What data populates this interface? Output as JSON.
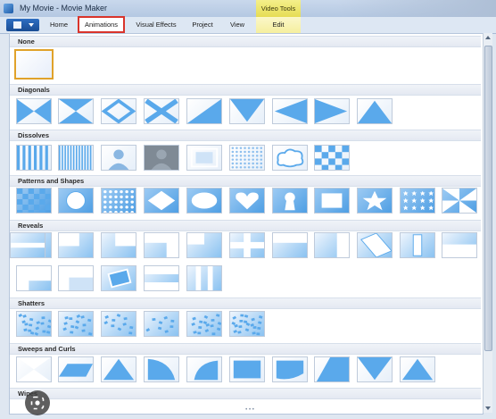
{
  "window": {
    "title": "My Movie - Movie Maker",
    "context_tab": "Video Tools"
  },
  "tabs": [
    {
      "label": "Home",
      "active": false
    },
    {
      "label": "Animations",
      "active": true
    },
    {
      "label": "Visual Effects",
      "active": false
    },
    {
      "label": "Project",
      "active": false
    },
    {
      "label": "View",
      "active": false
    },
    {
      "label": "Edit",
      "active": false
    }
  ],
  "gallery": {
    "sections": [
      {
        "label": "None",
        "items": [
          "none"
        ]
      },
      {
        "label": "Diagonals",
        "items": [
          "diag-x",
          "diag-x-out",
          "diag-diamond",
          "diag-x-bars",
          "diag-split",
          "diag-chevron-down",
          "diag-arrow-left",
          "diag-arrow-right",
          "diag-triangle-up"
        ]
      },
      {
        "label": "Dissolves",
        "items": [
          "dissolve-bars",
          "dissolve-lines",
          "dissolve-person",
          "dissolve-fade-dark",
          "dissolve-frames",
          "dissolve-dots",
          "dissolve-cloud",
          "dissolve-checker"
        ]
      },
      {
        "label": "Patterns and Shapes",
        "items": [
          "pattern-checker",
          "pattern-circle",
          "pattern-dots",
          "pattern-diamond",
          "pattern-ellipse",
          "pattern-heart",
          "pattern-keyhole",
          "pattern-rectangle",
          "pattern-star",
          "pattern-stars",
          "pattern-pinwheel"
        ]
      },
      {
        "label": "Reveals",
        "items": [
          "reveal-rotate",
          "reveal-corner-tl",
          "reveal-corner-tr",
          "reveal-slide-up",
          "reveal-box-br",
          "reveal-cross",
          "reveal-band",
          "reveal-bar-right",
          "reveal-tilt",
          "reveal-bar-center",
          "reveal-bar-top",
          "reveal-split-h",
          "reveal-corner-bl",
          "reveal-box-tl",
          "reveal-tilted-card",
          "reveal-split-v",
          "reveal-bars-v"
        ]
      },
      {
        "label": "Shatters",
        "items": [
          "shatter-1",
          "shatter-2",
          "shatter-3",
          "shatter-4",
          "shatter-5",
          "shatter-6"
        ]
      },
      {
        "label": "Sweeps and Curls",
        "items": [
          "sweep-bowtie",
          "sweep-trapezoid",
          "sweep-triangle",
          "curl-left",
          "curl-corner",
          "curl-page",
          "curl-bottom",
          "sweep-diagonal",
          "sweep-chevron",
          "sweep-triangle-up"
        ]
      },
      {
        "label": "Wipes",
        "items": []
      }
    ]
  },
  "colors": {
    "accent": "#d9342b",
    "selection": "#e0a22a",
    "thumb_blue": "#6cb0ec"
  },
  "icons": {
    "file_menu": "document-menu-icon",
    "lens": "lens-search-icon"
  }
}
